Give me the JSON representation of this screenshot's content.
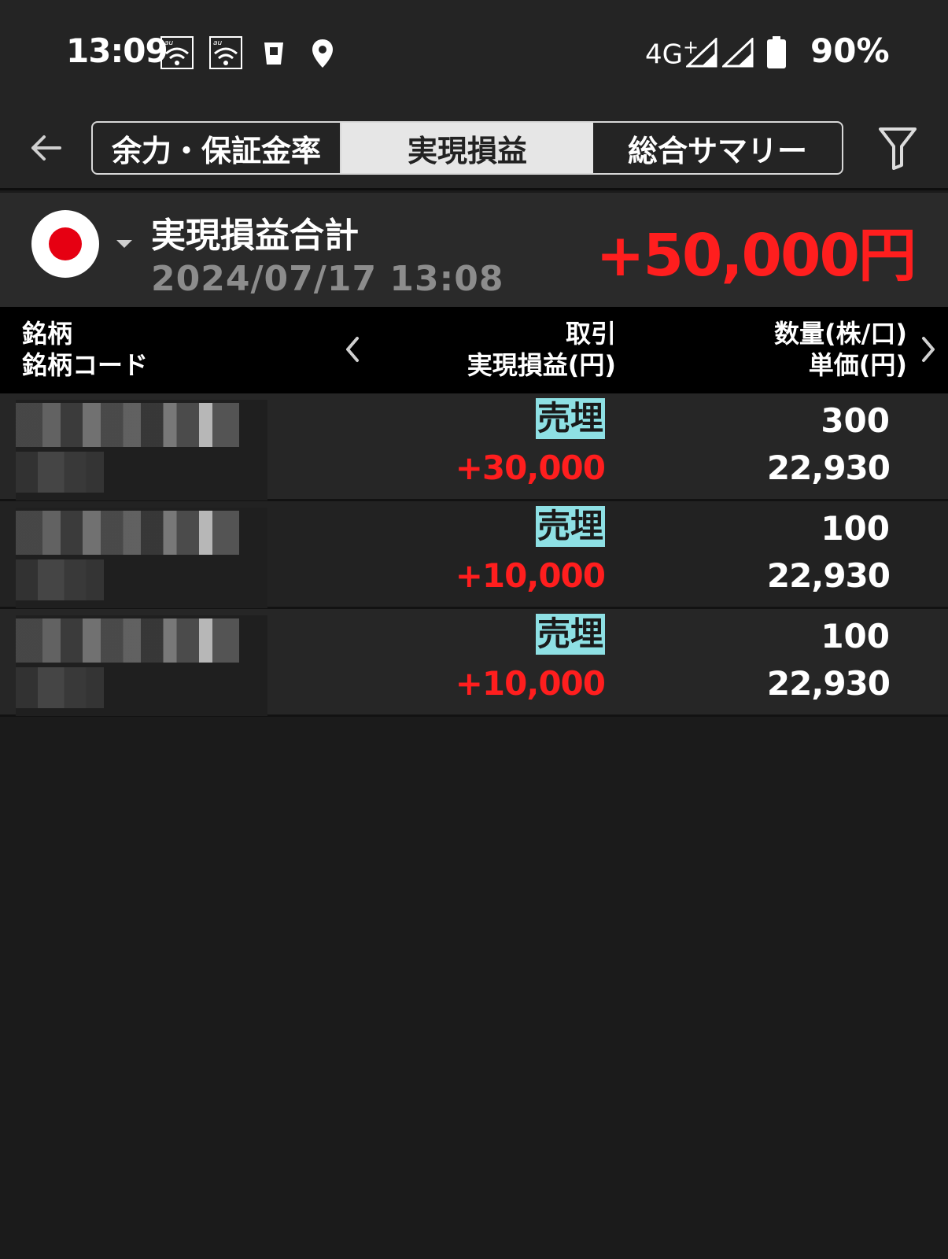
{
  "status_bar": {
    "time": "13:09",
    "network": "4G",
    "network_sup": "+",
    "battery": "90%",
    "icons": [
      "au-wifi-icon",
      "au-wifi-icon",
      "cup-icon",
      "location-pin-icon",
      "signal-icon",
      "signal-icon",
      "battery-icon"
    ]
  },
  "tabs": [
    {
      "label": "余力・保証金率",
      "selected": false
    },
    {
      "label": "実現損益",
      "selected": true
    },
    {
      "label": "総合サマリー",
      "selected": false
    }
  ],
  "summary": {
    "title": "実現損益合計",
    "datetime": "2024/07/17  13:08",
    "total": "+50,000円"
  },
  "columns": {
    "left_line1": "銘柄",
    "left_line2": "銘柄コード",
    "mid_line1": "取引",
    "mid_line2": "実現損益(円)",
    "right_line1": "数量(株/口)",
    "right_line2": "単価(円)"
  },
  "rows": [
    {
      "trade": "売埋",
      "pl": "+30,000",
      "qty": "300",
      "price": "22,930"
    },
    {
      "trade": "売埋",
      "pl": "+10,000",
      "qty": "100",
      "price": "22,930"
    },
    {
      "trade": "売埋",
      "pl": "+10,000",
      "qty": "100",
      "price": "22,930"
    }
  ],
  "colors": {
    "background": "#1b1b1b",
    "profit_red": "#ff1e1e",
    "badge_cyan": "#8ee0e4",
    "header_black": "#000000",
    "flag_red": "#e60012"
  }
}
